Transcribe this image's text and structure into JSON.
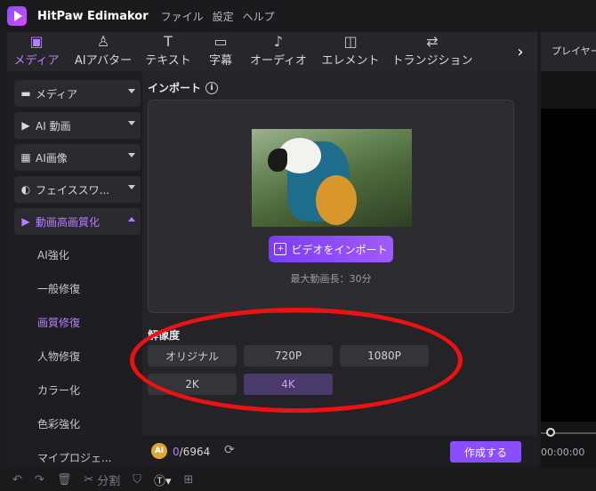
{
  "app": {
    "name": "HitPaw Edimakor",
    "menu": [
      "ファイル",
      "設定",
      "ヘルプ"
    ]
  },
  "toolbar": {
    "tabs": [
      {
        "label": "メディア",
        "icon": "media-icon",
        "active": true
      },
      {
        "label": "AIアバター",
        "icon": "ai-avatar-icon",
        "active": false
      },
      {
        "label": "テキスト",
        "icon": "text-icon",
        "active": false
      },
      {
        "label": "字幕",
        "icon": "subtitle-icon",
        "active": false
      },
      {
        "label": "オーディオ",
        "icon": "audio-icon",
        "active": false
      },
      {
        "label": "エレメント",
        "icon": "element-icon",
        "active": false
      },
      {
        "label": "トランジション",
        "icon": "transition-icon",
        "active": false
      }
    ]
  },
  "right_panel": {
    "tab": "プレイヤー",
    "time": "00:00:00"
  },
  "sidebar": {
    "items": [
      {
        "label": "メディア",
        "icon": "folder-icon"
      },
      {
        "label": "AI 動画",
        "icon": "ai-video-icon"
      },
      {
        "label": "AI画像",
        "icon": "ai-image-icon"
      },
      {
        "label": "フェイススワ...",
        "icon": "face-swap-icon"
      },
      {
        "label": "動画高画質化",
        "icon": "enhance-icon"
      }
    ],
    "subitems": [
      "AI強化",
      "一般修復",
      "画質修復",
      "人物修復",
      "カラー化",
      "色彩強化",
      "マイプロジェ..."
    ]
  },
  "main": {
    "import_title": "インポート",
    "import_button": "ビデオをインポート",
    "max_length": "最大動画長：30分",
    "resolution_title": "解像度",
    "resolutions": [
      "オリジナル",
      "720P",
      "1080P",
      "2K",
      "4K"
    ],
    "selected_resolution": "4K",
    "credits_used": "0",
    "credits_total": "/6964",
    "create_button": "作成する"
  },
  "bottom_tools": {
    "split": "分割"
  },
  "colors": {
    "accent": "#8a4dff",
    "highlight": "#b77dff",
    "annotation": "#ee1111"
  }
}
